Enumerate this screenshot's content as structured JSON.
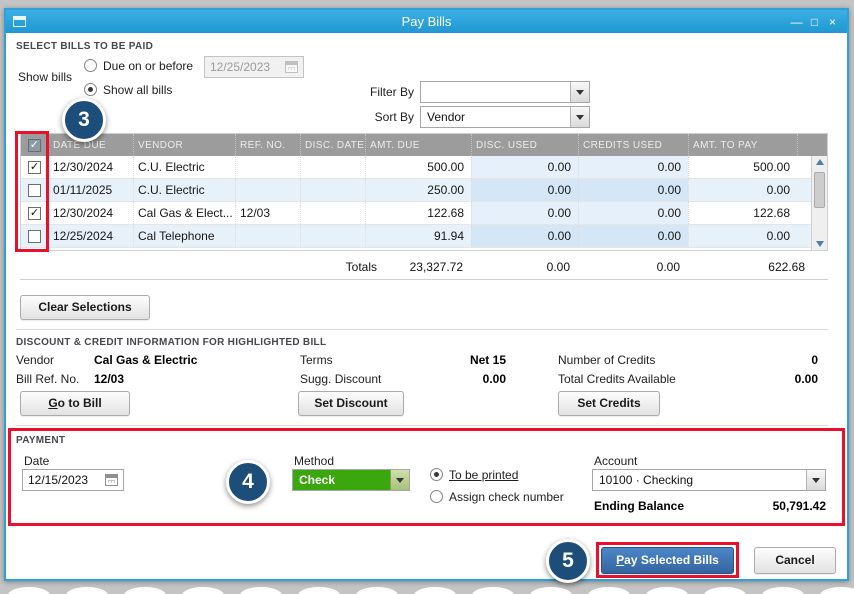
{
  "colors": {
    "titlebar_blue": "#2aa2dc",
    "annotation_red": "#e8112d",
    "badge_navy": "#1d4e79",
    "method_green": "#3ba70e",
    "primary_button_blue": "#3a76be",
    "row_alt_blue": "#e7f1fa"
  },
  "window": {
    "title": "Pay Bills",
    "minimize": "—",
    "maximize": "□",
    "close": "×"
  },
  "select_bills": {
    "section_title": "SELECT BILLS TO BE PAID",
    "show_bills_label": "Show bills",
    "due_on_or_before_label": "Due on or before",
    "due_date_value": "12/25/2023",
    "show_all_bills_label": "Show all bills",
    "filter_by_label": "Filter By",
    "filter_by_value": "",
    "sort_by_label": "Sort By",
    "sort_by_value": "Vendor"
  },
  "table": {
    "headers": [
      "DATE DUE",
      "VENDOR",
      "REF. NO.",
      "DISC. DATE",
      "AMT. DUE",
      "DISC. USED",
      "CREDITS USED",
      "AMT. TO PAY"
    ],
    "rows": [
      {
        "checked": true,
        "date_due": "12/30/2024",
        "vendor": "C.U. Electric",
        "ref_no": "",
        "disc_date": "",
        "amt_due": "500.00",
        "disc_used": "0.00",
        "credits_used": "0.00",
        "amt_to_pay": "500.00"
      },
      {
        "checked": false,
        "date_due": "01/11/2025",
        "vendor": "C.U. Electric",
        "ref_no": "",
        "disc_date": "",
        "amt_due": "250.00",
        "disc_used": "0.00",
        "credits_used": "0.00",
        "amt_to_pay": "0.00"
      },
      {
        "checked": true,
        "date_due": "12/30/2024",
        "vendor": "Cal Gas & Elect...",
        "ref_no": "12/03",
        "disc_date": "",
        "amt_due": "122.68",
        "disc_used": "0.00",
        "credits_used": "0.00",
        "amt_to_pay": "122.68"
      },
      {
        "checked": false,
        "date_due": "12/25/2024",
        "vendor": "Cal Telephone",
        "ref_no": "",
        "disc_date": "",
        "amt_due": "91.94",
        "disc_used": "0.00",
        "credits_used": "0.00",
        "amt_to_pay": "0.00"
      }
    ],
    "totals_label": "Totals",
    "totals": {
      "amt_due": "23,327.72",
      "disc_used": "0.00",
      "credits_used": "0.00",
      "amt_to_pay": "622.68"
    }
  },
  "buttons": {
    "clear_selections": "Clear Selections",
    "go_to_bill": "Go to Bill",
    "set_discount": "Set Discount",
    "set_credits": "Set Credits",
    "pay_selected_bills": "Pay Selected Bills",
    "cancel": "Cancel"
  },
  "discount_credit": {
    "section_title": "DISCOUNT & CREDIT INFORMATION FOR HIGHLIGHTED BILL",
    "vendor_label": "Vendor",
    "vendor_value": "Cal Gas & Electric",
    "bill_ref_label": "Bill Ref. No.",
    "bill_ref_value": "12/03",
    "terms_label": "Terms",
    "terms_value": "Net 15",
    "sugg_discount_label": "Sugg. Discount",
    "sugg_discount_value": "0.00",
    "number_of_credits_label": "Number of Credits",
    "number_of_credits_value": "0",
    "total_credits_label": "Total Credits Available",
    "total_credits_value": "0.00"
  },
  "payment": {
    "section_title": "PAYMENT",
    "date_label": "Date",
    "date_value": "12/15/2023",
    "method_label": "Method",
    "method_value": "Check",
    "to_be_printed_label": "To be printed",
    "assign_check_number_label": "Assign check number",
    "account_label": "Account",
    "account_value": "10100 · Checking",
    "ending_balance_label": "Ending Balance",
    "ending_balance_value": "50,791.42"
  },
  "annotations": {
    "step3": "3",
    "step4": "4",
    "step5": "5"
  }
}
